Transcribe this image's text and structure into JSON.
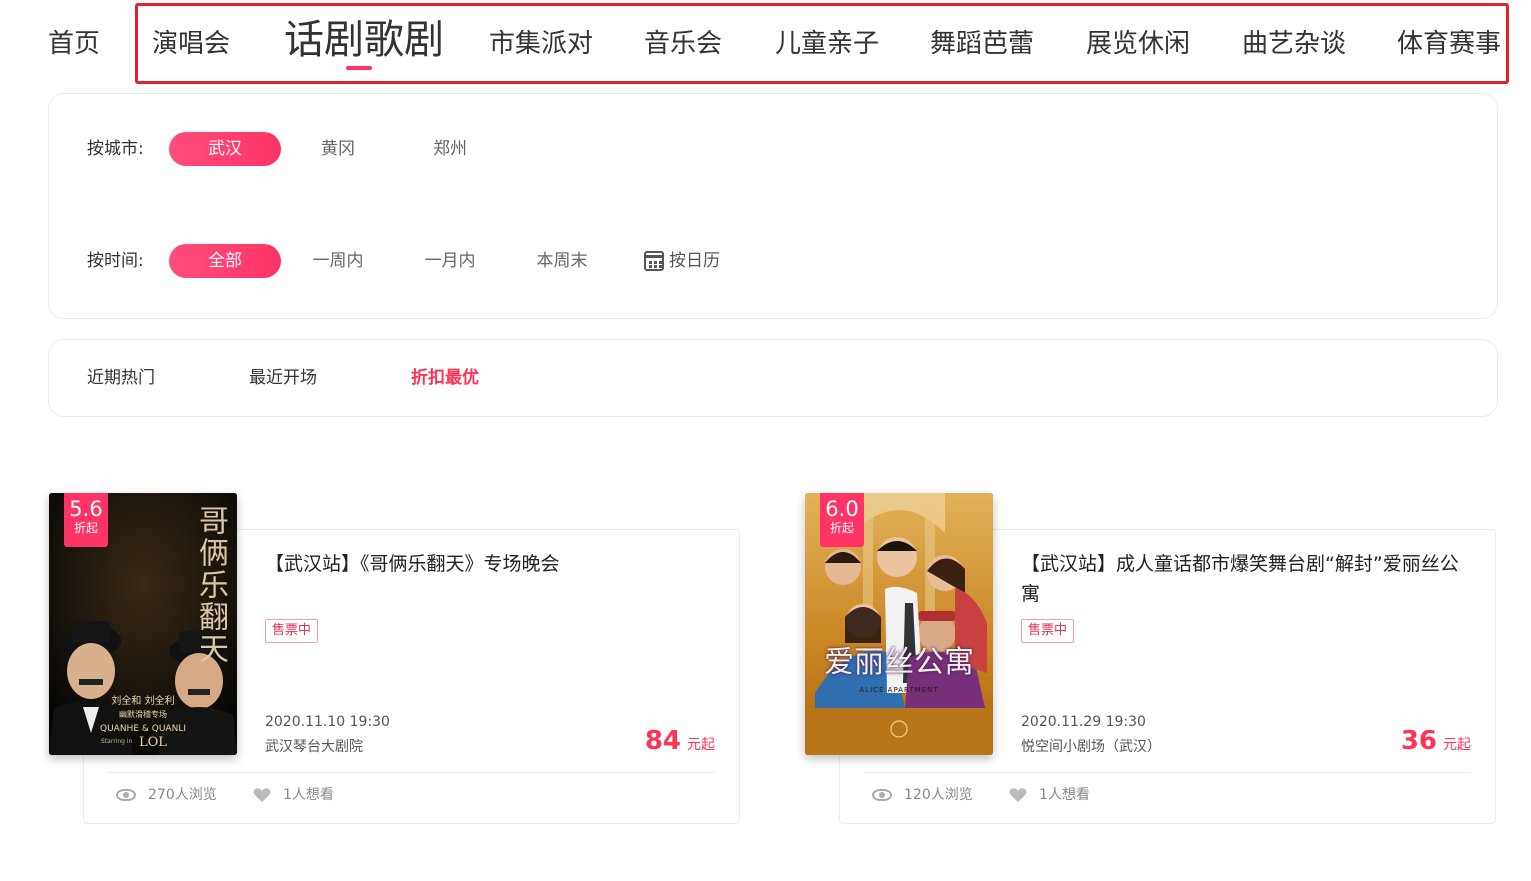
{
  "nav": {
    "items": [
      {
        "label": "首页"
      },
      {
        "label": "演唱会"
      },
      {
        "label": "话剧歌剧"
      },
      {
        "label": "市集派对"
      },
      {
        "label": "音乐会"
      },
      {
        "label": "儿童亲子"
      },
      {
        "label": "舞蹈芭蕾"
      },
      {
        "label": "展览休闲"
      },
      {
        "label": "曲艺杂谈"
      },
      {
        "label": "体育赛事"
      }
    ],
    "active_index": 2,
    "highlight_color": "#e0202a",
    "accent": "#ff3366"
  },
  "filters": {
    "city": {
      "label": "按城市:",
      "options": [
        "武汉",
        "黄冈",
        "郑州"
      ],
      "selected": "武汉"
    },
    "time": {
      "label": "按时间:",
      "options": [
        "全部",
        "一周内",
        "一月内",
        "本周末"
      ],
      "calendar_label": "按日历",
      "calendar_icon": "calendar-icon",
      "selected": "全部"
    }
  },
  "sort": {
    "options": [
      "近期热门",
      "最近开场",
      "折扣最优"
    ],
    "selected": "折扣最优"
  },
  "cards": [
    {
      "discount": "5.6",
      "discount_suffix": "折起",
      "title": "【武汉站】《哥俩乐翻天》专场晚会",
      "status": "售票中",
      "date": "2020.11.10 19:30",
      "venue": "武汉琴台大剧院",
      "price": "84",
      "price_unit": "元起",
      "views": "270人浏览",
      "wants": "1人想看",
      "poster": {
        "title_art": "哥俩乐翻天",
        "credit": "刘全和 刘全利",
        "subtitle": "幽默滑稽专场",
        "english": "QUANHE & QUANLI",
        "english_sub": "Starring in",
        "english_logo": "LOL"
      }
    },
    {
      "discount": "6.0",
      "discount_suffix": "折起",
      "title": "【武汉站】成人童话都市爆笑舞台剧“解封”爱丽丝公寓",
      "status": "售票中",
      "date": "2020.11.29 19:30",
      "venue": "悦空间小剧场（武汉）",
      "price": "36",
      "price_unit": "元起",
      "views": "120人浏览",
      "wants": "1人想看",
      "poster": {
        "title_art": "爱丽丝公寓",
        "english": "ALICE APARTMENT"
      }
    }
  ]
}
